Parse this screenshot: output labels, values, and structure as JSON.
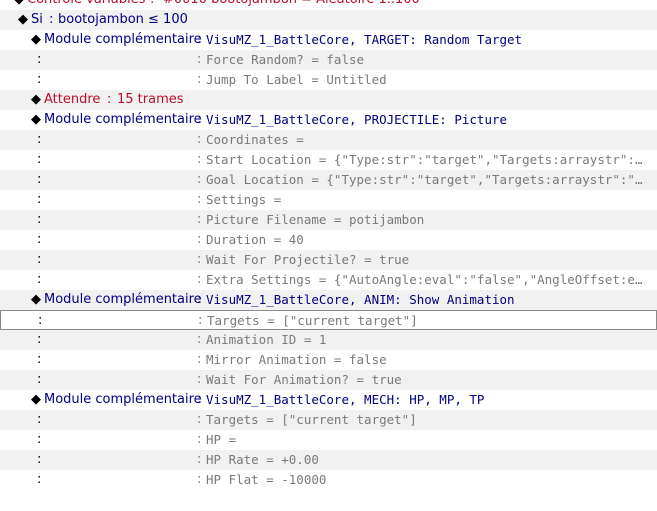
{
  "window": {
    "title": ""
  },
  "symbols": {
    "diamond": "◆",
    "colon": ":"
  },
  "colors": {
    "command": "#000080",
    "wait": "#b8102a",
    "param": "#7a7a7a",
    "selected_border": "#8a8a8a"
  },
  "rows": [
    {
      "kind": "top",
      "label": "Contrôle variables",
      "value": "#0010 bootojambon = Aléatoire 1..100",
      "color": "red"
    },
    {
      "kind": "if",
      "label": "Si",
      "value": "bootojambon ≤ 100"
    },
    {
      "kind": "module",
      "label": "Module complémentaire",
      "value": "VisuMZ_1_BattleCore, TARGET: Random Target"
    },
    {
      "kind": "param",
      "value": "Force Random? = false"
    },
    {
      "kind": "param",
      "value": "Jump To Label = Untitled"
    },
    {
      "kind": "wait",
      "label": "Attendre",
      "value": "15 trames"
    },
    {
      "kind": "module",
      "label": "Module complémentaire",
      "value": "VisuMZ_1_BattleCore, PROJECTILE: Picture"
    },
    {
      "kind": "param",
      "value": "Coordinates ="
    },
    {
      "kind": "param",
      "value": "Start Location = {\"Type:str\":\"target\",\"Targets:arraystr\":\"[…"
    },
    {
      "kind": "param",
      "value": "Goal Location = {\"Type:str\":\"target\",\"Targets:arraystr\":\"[\\…"
    },
    {
      "kind": "param",
      "value": "Settings ="
    },
    {
      "kind": "param",
      "value": "Picture Filename = potijambon"
    },
    {
      "kind": "param",
      "value": "Duration = 40"
    },
    {
      "kind": "param",
      "value": "Wait For Projectile? = true"
    },
    {
      "kind": "param",
      "value": "Extra Settings = {\"AutoAngle:eval\":\"false\",\"AngleOffset:eva…"
    },
    {
      "kind": "module",
      "label": "Module complémentaire",
      "value": "VisuMZ_1_BattleCore, ANIM: Show Animation"
    },
    {
      "kind": "param",
      "value": "Targets = [\"current target\"]",
      "selected": true
    },
    {
      "kind": "param",
      "value": "Animation ID = 1"
    },
    {
      "kind": "param",
      "value": "Mirror Animation = false"
    },
    {
      "kind": "param",
      "value": "Wait For Animation? = true"
    },
    {
      "kind": "module",
      "label": "Module complémentaire",
      "value": "VisuMZ_1_BattleCore, MECH: HP, MP, TP"
    },
    {
      "kind": "param",
      "value": "Targets = [\"current target\"]"
    },
    {
      "kind": "param",
      "value": "HP ="
    },
    {
      "kind": "param",
      "value": "HP Rate = +0.00"
    },
    {
      "kind": "param",
      "value": "HP Flat = -10000"
    }
  ]
}
